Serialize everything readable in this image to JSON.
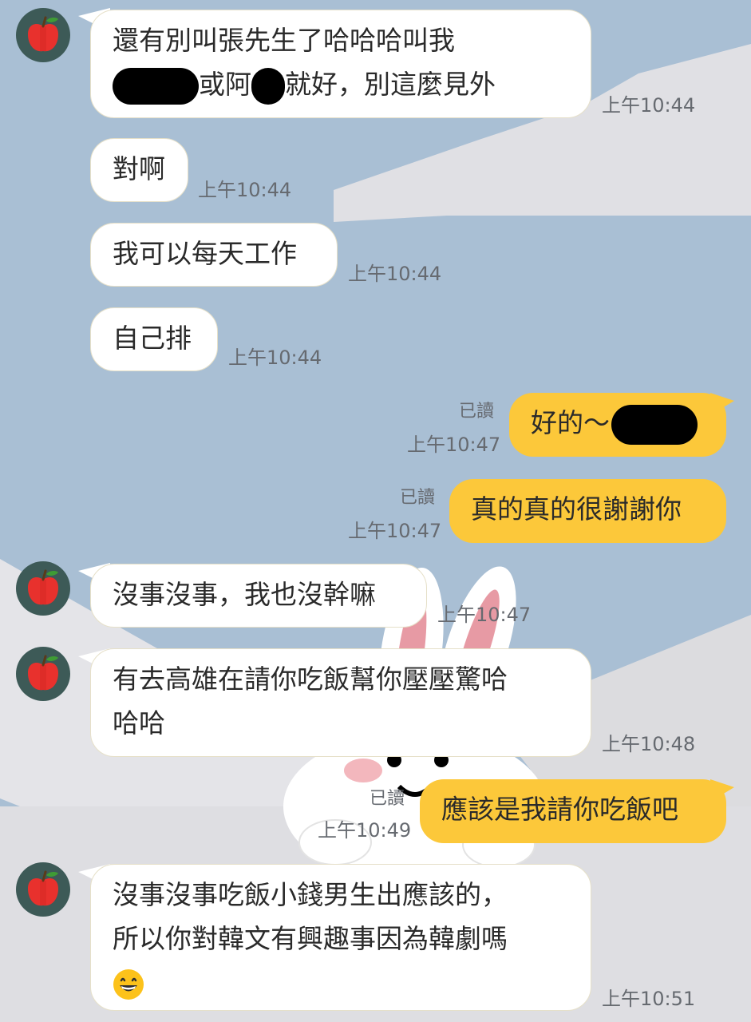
{
  "colors": {
    "background": "#a9bfd4",
    "incoming_bubble": "#ffffff",
    "outgoing_bubble": "#fcc83a",
    "avatar_bg": "#3d5a57"
  },
  "contact": {
    "avatar_icon": "apple-icon"
  },
  "messages": [
    {
      "direction": "in",
      "line1": "還有別叫張先生了哈哈哈叫我",
      "line2_a": "或阿",
      "line2_b": "就好，別這麼見外",
      "time": "上午10:44"
    },
    {
      "direction": "in",
      "text": "對啊",
      "time": "上午10:44"
    },
    {
      "direction": "in",
      "text": "我可以每天工作",
      "time": "上午10:44"
    },
    {
      "direction": "in",
      "text": "自己排",
      "time": "上午10:44"
    },
    {
      "direction": "out",
      "text": "好的～",
      "read": "已讀",
      "time": "上午10:47"
    },
    {
      "direction": "out",
      "text": "真的真的很謝謝你",
      "read": "已讀",
      "time": "上午10:47"
    },
    {
      "direction": "in",
      "text": "沒事沒事，我也沒幹嘛",
      "time": "上午10:47"
    },
    {
      "direction": "in",
      "line1": "有去高雄在請你吃飯幫你壓壓驚哈",
      "line2": "哈哈",
      "time": "上午10:48"
    },
    {
      "direction": "out",
      "text": "應該是我請你吃飯吧",
      "read": "已讀",
      "time": "上午10:49"
    },
    {
      "direction": "in",
      "line1": "沒事沒事吃飯小錢男生出應該的，",
      "line2": "所以你對韓文有興趣事因為韓劇嗎",
      "emoji": "grinning-face-emoji",
      "time": "上午10:51"
    }
  ]
}
